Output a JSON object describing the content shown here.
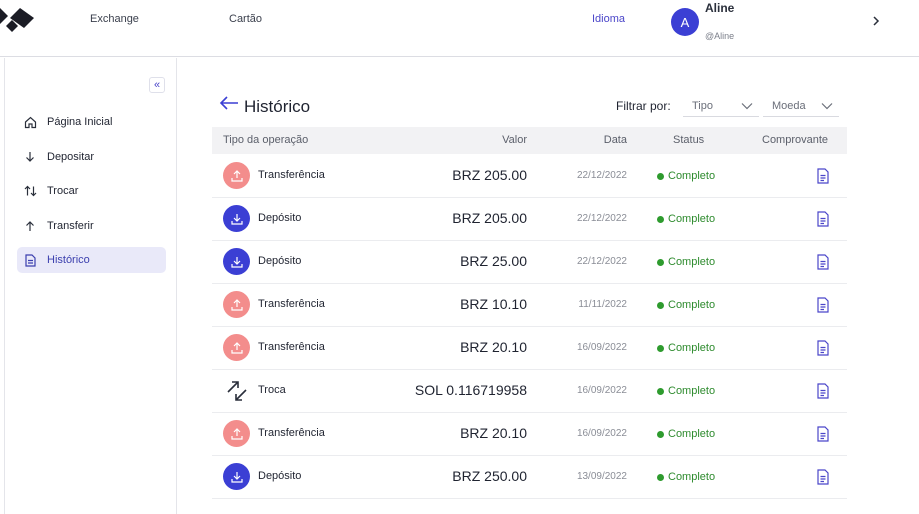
{
  "topbar": {
    "nav": [
      "Exchange",
      "Cartão"
    ],
    "language_label": "Idioma",
    "user": {
      "avatar_letter": "A",
      "name": "Aline",
      "handle": "@Aline"
    }
  },
  "sidebar": {
    "collapse_label": "«",
    "items": [
      {
        "label": "Página Inicial",
        "icon": "home-icon"
      },
      {
        "label": "Depositar",
        "icon": "arrow-down-icon"
      },
      {
        "label": "Trocar",
        "icon": "swap-icon"
      },
      {
        "label": "Transferir",
        "icon": "arrow-up-icon"
      },
      {
        "label": "Histórico",
        "icon": "document-icon",
        "active": true
      }
    ]
  },
  "main": {
    "title": "Histórico",
    "filter": {
      "label": "Filtrar por:",
      "tipo": "Tipo",
      "moeda": "Moeda"
    },
    "columns": [
      "Tipo da operação",
      "Valor",
      "Data",
      "Status",
      "Comprovante"
    ],
    "rows": [
      {
        "type": "out",
        "operation": "Transferência",
        "value": "BRZ 205.00",
        "date": "22/12/2022",
        "status": "Completo"
      },
      {
        "type": "in",
        "operation": "Depósito",
        "value": "BRZ 205.00",
        "date": "22/12/2022",
        "status": "Completo"
      },
      {
        "type": "in",
        "operation": "Depósito",
        "value": "BRZ 25.00",
        "date": "22/12/2022",
        "status": "Completo"
      },
      {
        "type": "out",
        "operation": "Transferência",
        "value": "BRZ 10.10",
        "date": "11/11/2022",
        "status": "Completo"
      },
      {
        "type": "out",
        "operation": "Transferência",
        "value": "BRZ 20.10",
        "date": "16/09/2022",
        "status": "Completo"
      },
      {
        "type": "swap",
        "operation": "Troca",
        "value": "SOL 0.116719958",
        "date": "16/09/2022",
        "status": "Completo"
      },
      {
        "type": "out",
        "operation": "Transferência",
        "value": "BRZ 20.10",
        "date": "16/09/2022",
        "status": "Completo"
      },
      {
        "type": "in",
        "operation": "Depósito",
        "value": "BRZ 250.00",
        "date": "13/09/2022",
        "status": "Completo"
      }
    ]
  },
  "colors": {
    "accent": "#3b3fd4",
    "transfer": "#f38d8c",
    "status_ok": "#2e9b2e"
  }
}
